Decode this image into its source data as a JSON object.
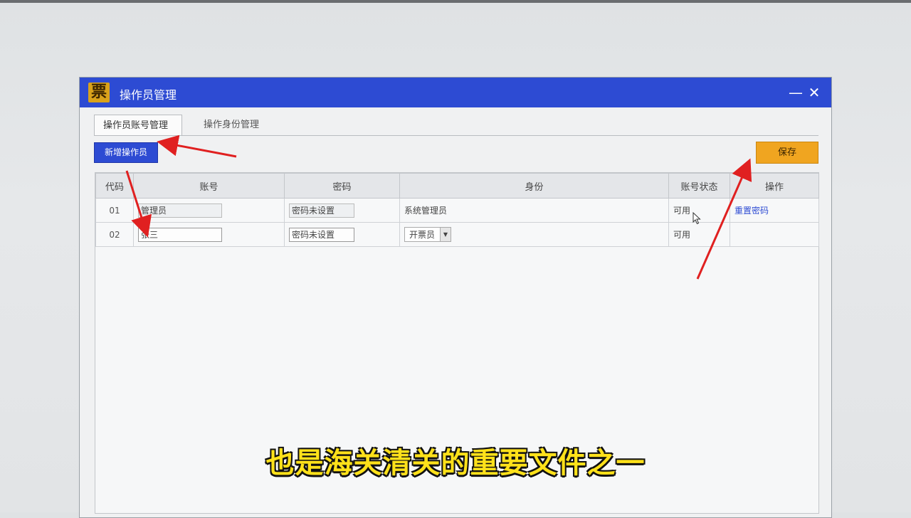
{
  "window": {
    "title": "操作员管理",
    "logo_char": "票",
    "minimize_symbol": "—",
    "close_symbol": "✕"
  },
  "tabs": [
    {
      "label": "操作员账号管理",
      "active": true
    },
    {
      "label": "操作身份管理",
      "active": false
    }
  ],
  "toolbar": {
    "add_label": "新增操作员",
    "save_label": "保存"
  },
  "table": {
    "columns": [
      "代码",
      "账号",
      "密码",
      "身份",
      "账号状态",
      "操作"
    ],
    "rows": [
      {
        "code": "01",
        "account": "管理员",
        "password": "密码未设置",
        "role": "系统管理员",
        "status": "可用",
        "action": "重置密码"
      },
      {
        "code": "02",
        "account": "张三",
        "password": "密码未设置",
        "role": "开票员",
        "status": "可用",
        "action": ""
      }
    ]
  },
  "caption": "也是海关清关的重要文件之一",
  "colors": {
    "titlebar": "#2d4bd3",
    "save_button": "#f0a520",
    "annotation_arrow": "#e02020",
    "caption_text": "#ffe11a"
  }
}
